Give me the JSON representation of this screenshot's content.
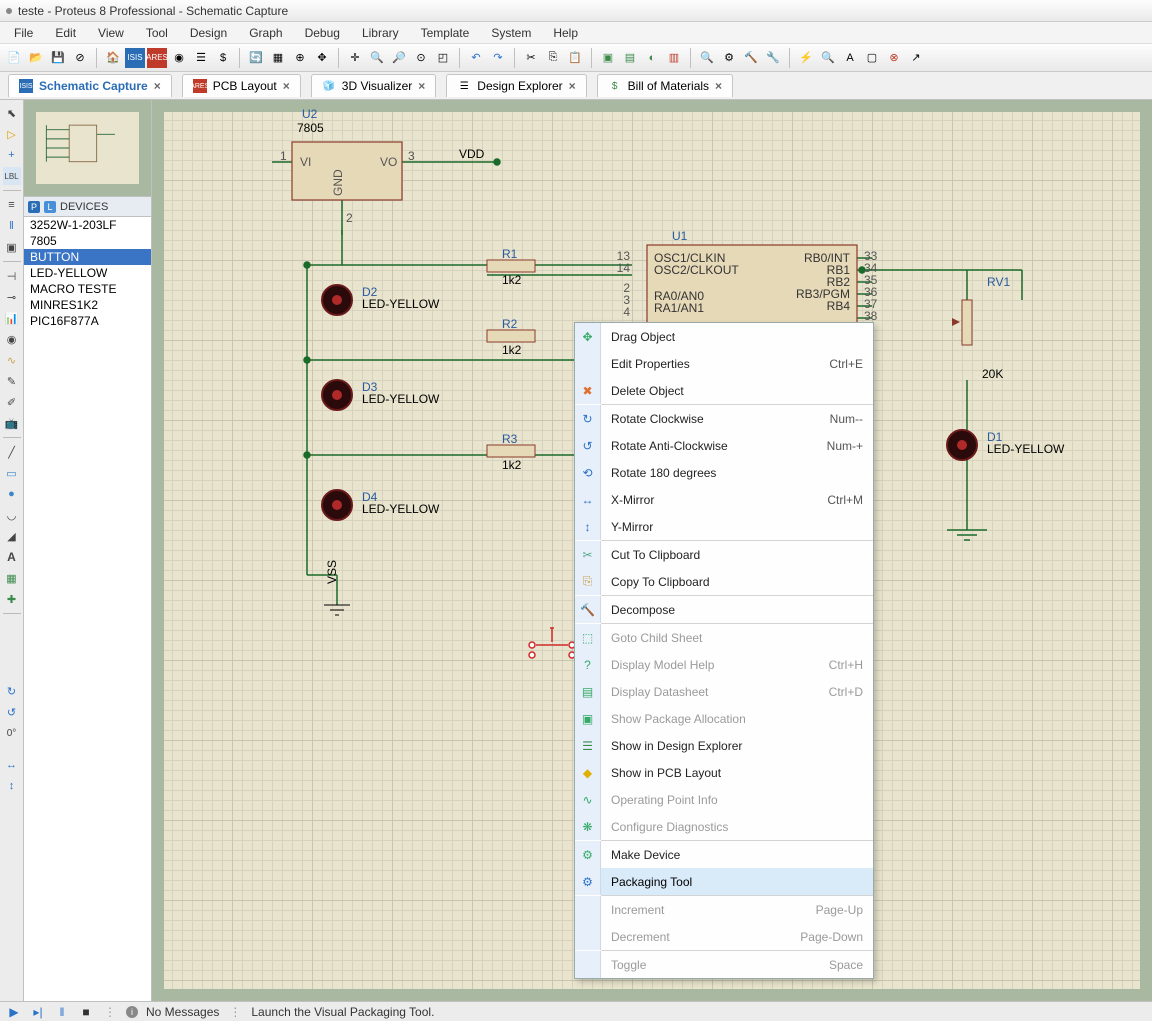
{
  "title": "teste - Proteus 8 Professional - Schematic Capture",
  "menus": [
    "File",
    "Edit",
    "View",
    "Tool",
    "Design",
    "Graph",
    "Debug",
    "Library",
    "Template",
    "System",
    "Help"
  ],
  "tabs": [
    {
      "label": "Schematic Capture",
      "active": true
    },
    {
      "label": "PCB Layout",
      "active": false
    },
    {
      "label": "3D Visualizer",
      "active": false
    },
    {
      "label": "Design Explorer",
      "active": false
    },
    {
      "label": "Bill of Materials",
      "active": false
    }
  ],
  "devices_header": "DEVICES",
  "devices": [
    "3252W-1-203LF",
    "7805",
    "BUTTON",
    "LED-YELLOW",
    "MACRO TESTE",
    "MINRES1K2",
    "PIC16F877A"
  ],
  "selected_device": "BUTTON",
  "status_nomsg": "No Messages",
  "status_hint": "Launch the Visual Packaging Tool.",
  "side_angle": "0°",
  "schematic": {
    "U2": {
      "ref": "U2",
      "val": "7805",
      "pins": {
        "VI": "VI",
        "VO": "VO",
        "GND": "GND",
        "p1": "1",
        "p3": "3"
      },
      "vdd": "VDD"
    },
    "U1": {
      "ref": "U1",
      "pins": {
        "13": "13",
        "14": "14",
        "2": "2",
        "3": "3",
        "4": "4",
        "33": "33",
        "34": "34",
        "35": "35",
        "36": "36",
        "37": "37",
        "38": "38",
        "OSC1": "OSC1/CLKIN",
        "OSC2": "OSC2/CLKOUT",
        "RA0": "RA0/AN0",
        "RA1": "RA1/AN1",
        "RB0": "RB0/INT",
        "RB1": "RB1",
        "RB2": "RB2",
        "RB3": "RB3/PGM",
        "RB4": "RB4"
      }
    },
    "R": {
      "R1": {
        "ref": "R1",
        "val": "1k2"
      },
      "R2": {
        "ref": "R2",
        "val": "1k2"
      },
      "R3": {
        "ref": "R3",
        "val": "1k2"
      }
    },
    "D": {
      "D1": {
        "ref": "D1",
        "val": "LED-YELLOW"
      },
      "D2": {
        "ref": "D2",
        "val": "LED-YELLOW"
      },
      "D3": {
        "ref": "D3",
        "val": "LED-YELLOW"
      },
      "D4": {
        "ref": "D4",
        "val": "LED-YELLOW"
      }
    },
    "RV1": {
      "ref": "RV1",
      "val": "20K"
    },
    "VSS": "VSS",
    "p2": "2"
  },
  "context_menu": [
    {
      "icon": "✥",
      "label": "Drag Object",
      "shortcut": "",
      "disabled": false
    },
    {
      "icon": "",
      "label": "Edit Properties",
      "shortcut": "Ctrl+E",
      "disabled": false
    },
    {
      "icon": "✖",
      "label": "Delete Object",
      "shortcut": "",
      "disabled": false,
      "iconColor": "#e07030"
    },
    {
      "sep": true
    },
    {
      "icon": "↻",
      "label": "Rotate Clockwise",
      "shortcut": "Num--",
      "disabled": false,
      "iconColor": "#2a72c8"
    },
    {
      "icon": "↺",
      "label": "Rotate Anti-Clockwise",
      "shortcut": "Num-+",
      "disabled": false,
      "iconColor": "#2a72c8"
    },
    {
      "icon": "⟲",
      "label": "Rotate 180 degrees",
      "shortcut": "",
      "disabled": false,
      "iconColor": "#2a72c8"
    },
    {
      "icon": "↔",
      "label": "X-Mirror",
      "shortcut": "Ctrl+M",
      "disabled": false,
      "iconColor": "#2a72c8"
    },
    {
      "icon": "↕",
      "label": "Y-Mirror",
      "shortcut": "",
      "disabled": false,
      "iconColor": "#2a72c8"
    },
    {
      "sep": true
    },
    {
      "icon": "✂",
      "label": "Cut To Clipboard",
      "shortcut": "",
      "disabled": false,
      "iconColor": "#5a8"
    },
    {
      "icon": "⎘",
      "label": "Copy To Clipboard",
      "shortcut": "",
      "disabled": false,
      "iconColor": "#c9a24a"
    },
    {
      "sep": true
    },
    {
      "icon": "🔨",
      "label": "Decompose",
      "shortcut": "",
      "disabled": false
    },
    {
      "sep": true
    },
    {
      "icon": "⬚",
      "label": "Goto Child Sheet",
      "shortcut": "",
      "disabled": true
    },
    {
      "icon": "?",
      "label": "Display Model Help",
      "shortcut": "Ctrl+H",
      "disabled": true
    },
    {
      "icon": "▤",
      "label": "Display Datasheet",
      "shortcut": "Ctrl+D",
      "disabled": true
    },
    {
      "icon": "▣",
      "label": "Show Package Allocation",
      "shortcut": "",
      "disabled": true
    },
    {
      "icon": "☰",
      "label": "Show in Design Explorer",
      "shortcut": "",
      "disabled": false,
      "iconColor": "#3a8a4a"
    },
    {
      "icon": "◆",
      "label": "Show in PCB Layout",
      "shortcut": "",
      "disabled": false,
      "iconColor": "#e0b000"
    },
    {
      "icon": "∿",
      "label": "Operating Point Info",
      "shortcut": "",
      "disabled": true
    },
    {
      "icon": "❋",
      "label": "Configure Diagnostics",
      "shortcut": "",
      "disabled": true
    },
    {
      "sep": true
    },
    {
      "icon": "⚙",
      "label": "Make Device",
      "shortcut": "",
      "disabled": false
    },
    {
      "icon": "⚙",
      "label": "Packaging Tool",
      "shortcut": "",
      "disabled": false,
      "highlight": true,
      "iconColor": "#2a72c8"
    },
    {
      "sep": true
    },
    {
      "icon": "",
      "label": "Increment",
      "shortcut": "Page-Up",
      "disabled": true
    },
    {
      "icon": "",
      "label": "Decrement",
      "shortcut": "Page-Down",
      "disabled": true
    },
    {
      "sep": true
    },
    {
      "icon": "",
      "label": "Toggle",
      "shortcut": "Space",
      "disabled": true
    }
  ]
}
